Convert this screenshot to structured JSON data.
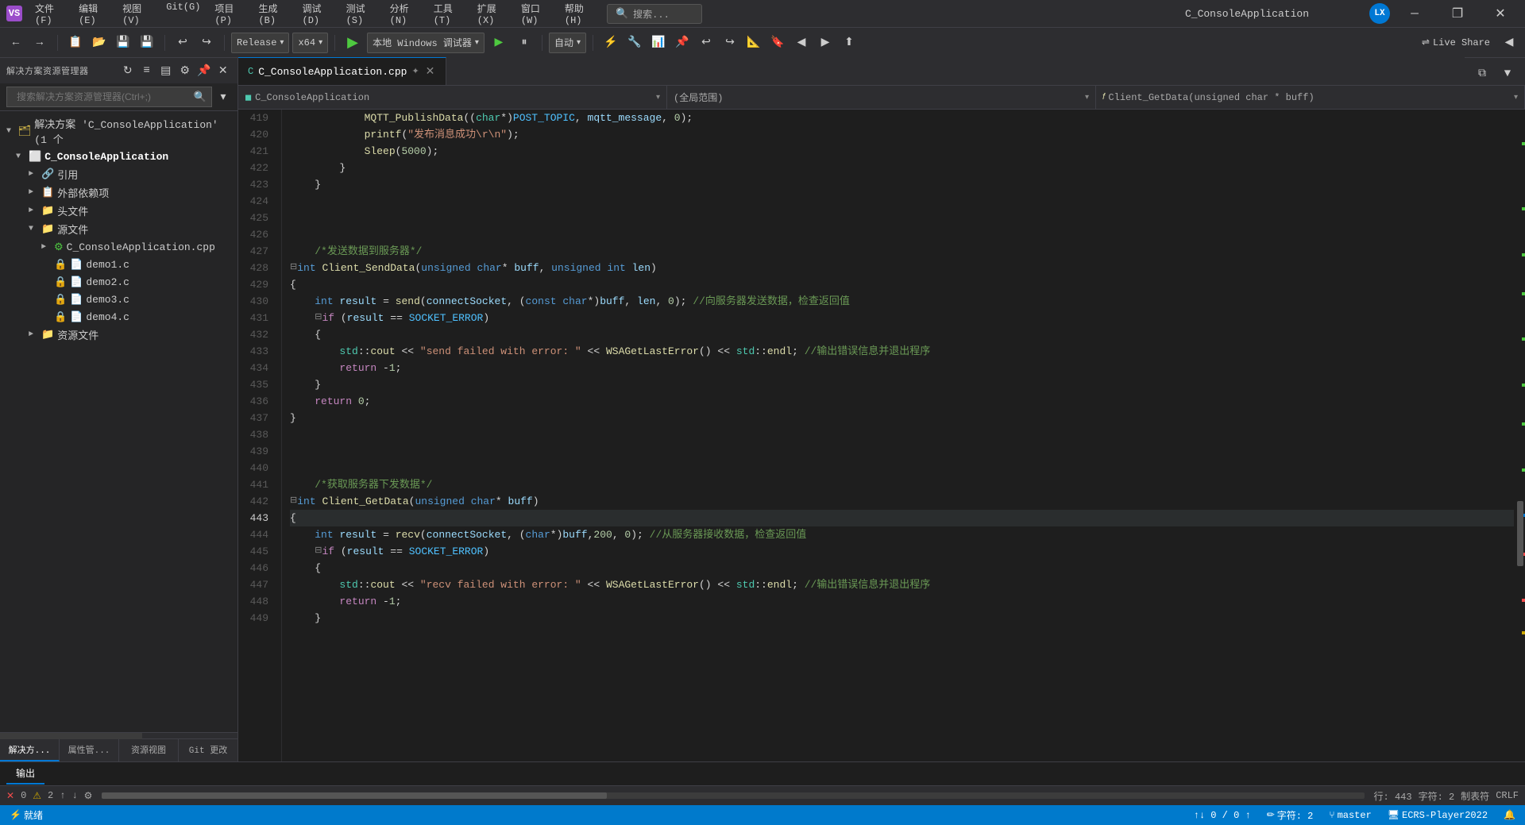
{
  "title_bar": {
    "icon_text": "VS",
    "menu_items": [
      "文件(F)",
      "编辑(E)",
      "视图(V)",
      "Git(G)",
      "项目(P)",
      "生成(B)",
      "调试(D)",
      "测试(S)",
      "分析(N)",
      "工具(T)",
      "扩展(X)",
      "窗口(W)",
      "帮助(H)"
    ],
    "search_placeholder": "搜索...",
    "title": "C_ConsoleApplication",
    "user_avatar": "LX",
    "controls": [
      "—",
      "❐",
      "✕"
    ]
  },
  "toolbar": {
    "back_btn": "←",
    "forward_btn": "→",
    "config_dropdown": "Release",
    "arch_dropdown": "x64",
    "debug_target": "本地 Windows 调试器",
    "auto_dropdown": "自动",
    "live_share_label": "Live Share"
  },
  "sidebar": {
    "header": "解决方案资源管理器",
    "search_placeholder": "搜索解决方案资源管理器(Ctrl+;)",
    "tree": [
      {
        "label": "解决方案 'C_ConsoleApplication' (1 个",
        "indent": 0,
        "icon": "🗂",
        "arrow": "▼"
      },
      {
        "label": "C_ConsoleApplication",
        "indent": 1,
        "icon": "📦",
        "arrow": "▼",
        "bold": true
      },
      {
        "label": "引用",
        "indent": 2,
        "icon": "🔗",
        "arrow": "►"
      },
      {
        "label": "外部依赖项",
        "indent": 2,
        "icon": "📋",
        "arrow": "►"
      },
      {
        "label": "头文件",
        "indent": 2,
        "icon": "📁",
        "arrow": "►"
      },
      {
        "label": "源文件",
        "indent": 2,
        "icon": "📁",
        "arrow": "▼"
      },
      {
        "label": "C_ConsoleApplication.cpp",
        "indent": 3,
        "icon": "⚙",
        "arrow": "►"
      },
      {
        "label": "demo1.c",
        "indent": 3,
        "icon": "🔒"
      },
      {
        "label": "demo2.c",
        "indent": 3,
        "icon": "🔒"
      },
      {
        "label": "demo3.c",
        "indent": 3,
        "icon": "🔒"
      },
      {
        "label": "demo4.c",
        "indent": 3,
        "icon": "🔒"
      },
      {
        "label": "资源文件",
        "indent": 2,
        "icon": "📁",
        "arrow": "►"
      }
    ],
    "bottom_tabs": [
      "解决方...",
      "属性管...",
      "资源视图",
      "Git 更改"
    ]
  },
  "editor": {
    "tab_label": "C_ConsoleApplication.cpp",
    "nav_class": "C_ConsoleApplication",
    "nav_scope": "(全局范围)",
    "nav_function": "Client_GetData(unsigned char * buff)",
    "lines": [
      {
        "num": 419,
        "code": "            MQTT_PublishData((char*)POST_TOPIC, mqtt_message, 0);",
        "active": false
      },
      {
        "num": 420,
        "code": "            printf(\"发布消息成功\\r\\n\");",
        "active": false
      },
      {
        "num": 421,
        "code": "            Sleep(5000);",
        "active": false
      },
      {
        "num": 422,
        "code": "        }",
        "active": false
      },
      {
        "num": 423,
        "code": "    }",
        "active": false
      },
      {
        "num": 424,
        "code": "",
        "active": false
      },
      {
        "num": 425,
        "code": "",
        "active": false
      },
      {
        "num": 426,
        "code": "",
        "active": false
      },
      {
        "num": 427,
        "code": "    /*发送数据到服务器*/",
        "active": false
      },
      {
        "num": 428,
        "code": "int Client_SendData(unsigned char* buff, unsigned int len)",
        "active": false
      },
      {
        "num": 429,
        "code": "{",
        "active": false
      },
      {
        "num": 430,
        "code": "    int result = send(connectSocket, (const char*)buff, len, 0); //向服务器发送数据，检查返回值",
        "active": false
      },
      {
        "num": 431,
        "code": "    if (result == SOCKET_ERROR)",
        "active": false
      },
      {
        "num": 432,
        "code": "    {",
        "active": false
      },
      {
        "num": 433,
        "code": "        std::cout << \"send failed with error: \" << WSAGetLastError() << std::endl; //输出错误信息并退出程序",
        "active": false
      },
      {
        "num": 434,
        "code": "        return -1;",
        "active": false
      },
      {
        "num": 435,
        "code": "    }",
        "active": false
      },
      {
        "num": 436,
        "code": "    return 0;",
        "active": false
      },
      {
        "num": 437,
        "code": "}",
        "active": false
      },
      {
        "num": 438,
        "code": "",
        "active": false
      },
      {
        "num": 439,
        "code": "",
        "active": false
      },
      {
        "num": 440,
        "code": "",
        "active": false
      },
      {
        "num": 441,
        "code": "    /*获取服务器下发数据*/",
        "active": false
      },
      {
        "num": 442,
        "code": "int Client_GetData(unsigned char* buff)",
        "active": false
      },
      {
        "num": 443,
        "code": "{",
        "active": true
      },
      {
        "num": 444,
        "code": "    int result = recv(connectSocket, (char*)buff,200, 0); //从服务器接收数据，检查返回值",
        "active": false
      },
      {
        "num": 445,
        "code": "    if (result == SOCKET_ERROR)",
        "active": false
      },
      {
        "num": 446,
        "code": "    {",
        "active": false
      },
      {
        "num": 447,
        "code": "        std::cout << \"recv failed with error: \" << WSAGetLastError() << std::endl; //输出错误信息并退出程序",
        "active": false
      },
      {
        "num": 448,
        "code": "        return -1;",
        "active": false
      },
      {
        "num": 449,
        "code": "    }",
        "active": false
      }
    ]
  },
  "bottom_panel": {
    "tab_label": "输出"
  },
  "status_bar": {
    "git_icon": "⑂",
    "git_branch": "master",
    "errors": "0",
    "warnings": "2",
    "line": "行: 443",
    "col": "字符: 2",
    "tab_size": "制表符",
    "encoding": "CRLF",
    "ecrs": "ECRS-Player2022",
    "status_text": "就绪",
    "nav_indicator": "↑↓ 0 / 0 ↑"
  }
}
